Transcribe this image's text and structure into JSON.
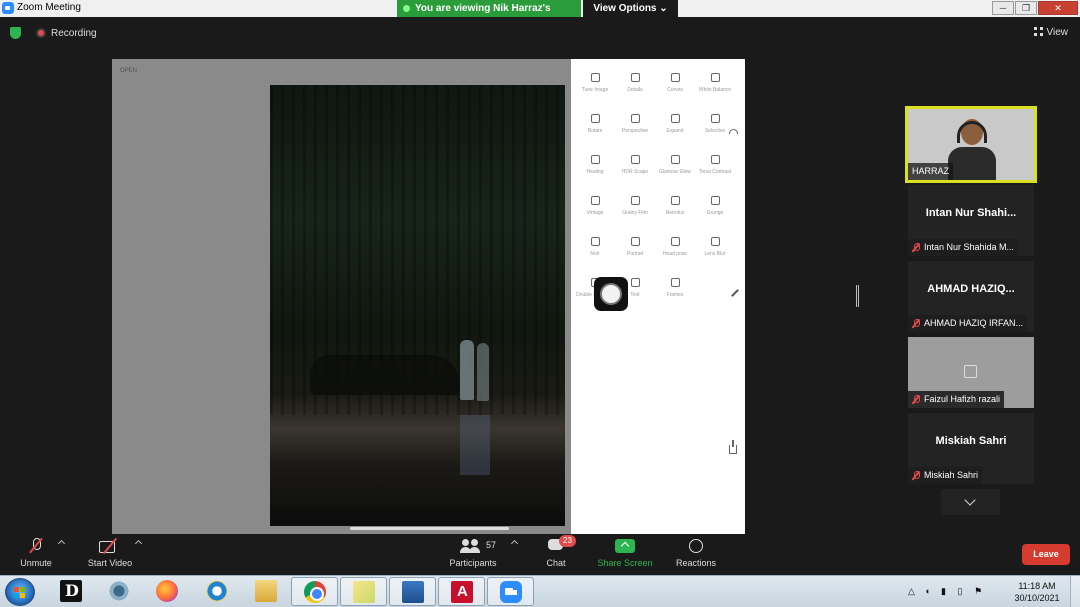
{
  "window": {
    "title": "Zoom Meeting",
    "share_banner": "You are viewing Nik Harraz's screen",
    "view_options": "View Options",
    "controls": [
      "─",
      "❐",
      "✕"
    ]
  },
  "meeting": {
    "recording_label": "Recording",
    "view_label": "View"
  },
  "shared_screen": {
    "top_left_label": "OPEN",
    "tools": [
      {
        "label": "Tune Image"
      },
      {
        "label": "Details"
      },
      {
        "label": "Curves"
      },
      {
        "label": "White Balance"
      },
      {
        "label": "Rotate"
      },
      {
        "label": "Perspective"
      },
      {
        "label": "Expand"
      },
      {
        "label": "Selective"
      },
      {
        "label": "Healing"
      },
      {
        "label": "HDR Scape"
      },
      {
        "label": "Glamour Glow"
      },
      {
        "label": "Tonal Contrast"
      },
      {
        "label": "Vintage"
      },
      {
        "label": "Grainy Film"
      },
      {
        "label": "Retrolux"
      },
      {
        "label": "Grunge"
      },
      {
        "label": "Noir"
      },
      {
        "label": "Portrait"
      },
      {
        "label": "Head pose"
      },
      {
        "label": "Lens Blur"
      },
      {
        "label": "Double exposure"
      },
      {
        "label": "Text"
      },
      {
        "label": "Frames"
      }
    ]
  },
  "participants": {
    "video": {
      "name": "HARRAZ"
    },
    "tiles": [
      {
        "big_name": "Intan Nur Shahi...",
        "tag": "Intan Nur Shahida M..."
      },
      {
        "big_name": "AHMAD HAZIQ...",
        "tag": "AHMAD HAZIQ IRFAN..."
      },
      {
        "big_name": "",
        "tag": "Faizul Hafizh razali"
      },
      {
        "big_name": "Miskiah Sahri",
        "tag": "Miskiah Sahri"
      }
    ]
  },
  "toolbar": {
    "unmute": "Unmute",
    "start_video": "Start Video",
    "participants": "Participants",
    "participant_count": "57",
    "chat": "Chat",
    "chat_badge": "23",
    "share_screen": "Share Screen",
    "reactions": "Reactions",
    "leave": "Leave"
  },
  "taskbar": {
    "time": "11:18 AM",
    "date": "30/10/2021"
  },
  "colors": {
    "accent_green": "#2eb551",
    "leave_red": "#d63b2f",
    "speaker_border": "#d8e021",
    "zoom_blue": "#2d8cff"
  }
}
